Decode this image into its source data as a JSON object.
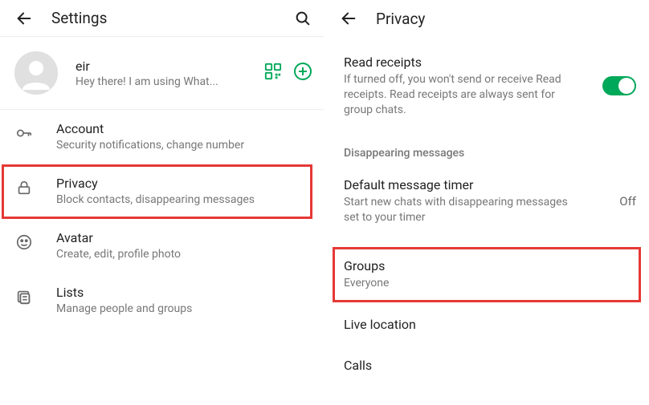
{
  "left": {
    "header_title": "Settings",
    "profile": {
      "name": "eir",
      "status": "Hey there! I am using What..."
    },
    "items": [
      {
        "title": "Account",
        "sub": "Security notifications, change number"
      },
      {
        "title": "Privacy",
        "sub": "Block contacts, disappearing messages"
      },
      {
        "title": "Avatar",
        "sub": "Create, edit, profile photo"
      },
      {
        "title": "Lists",
        "sub": "Manage people and groups"
      }
    ]
  },
  "right": {
    "header_title": "Privacy",
    "read_receipts": {
      "title": "Read receipts",
      "sub": "If turned off, you won't send or receive Read receipts. Read receipts are always sent for group chats."
    },
    "section_disappearing": "Disappearing messages",
    "default_timer": {
      "title": "Default message timer",
      "sub": "Start new chats with disappearing messages set to your timer",
      "value": "Off"
    },
    "groups": {
      "title": "Groups",
      "sub": "Everyone"
    },
    "live_location": {
      "title": "Live location"
    },
    "calls": {
      "title": "Calls"
    }
  }
}
